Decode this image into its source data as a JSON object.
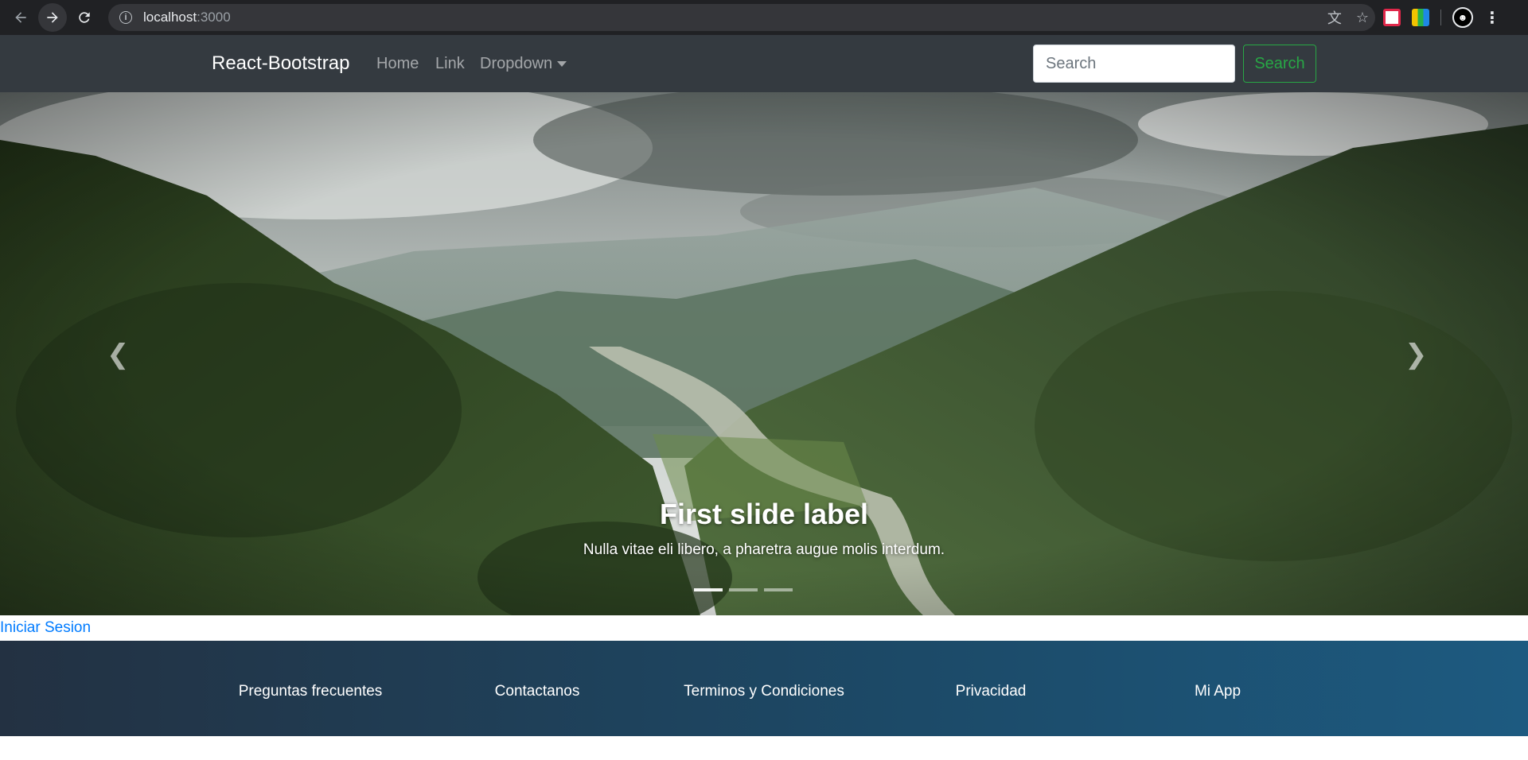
{
  "browser": {
    "url_host": "localhost",
    "url_port": ":3000"
  },
  "navbar": {
    "brand": "React-Bootstrap",
    "links": [
      "Home",
      "Link",
      "Dropdown"
    ],
    "search_placeholder": "Search",
    "search_button": "Search",
    "colors": {
      "background": "#343a40",
      "success": "#28a745"
    }
  },
  "carousel": {
    "prev_icon": "chevron-left-icon",
    "next_icon": "chevron-right-icon",
    "caption_title": "First slide label",
    "caption_text": "Nulla vitae eli libero, a pharetra augue molis interdum.",
    "slide_count": 3,
    "active_slide": 1
  },
  "login_link": "Iniciar Sesion",
  "footer": {
    "items": [
      "Preguntas frecuentes",
      "Contactanos",
      "Terminos y Condiciones",
      "Privacidad",
      "Mi App"
    ]
  }
}
